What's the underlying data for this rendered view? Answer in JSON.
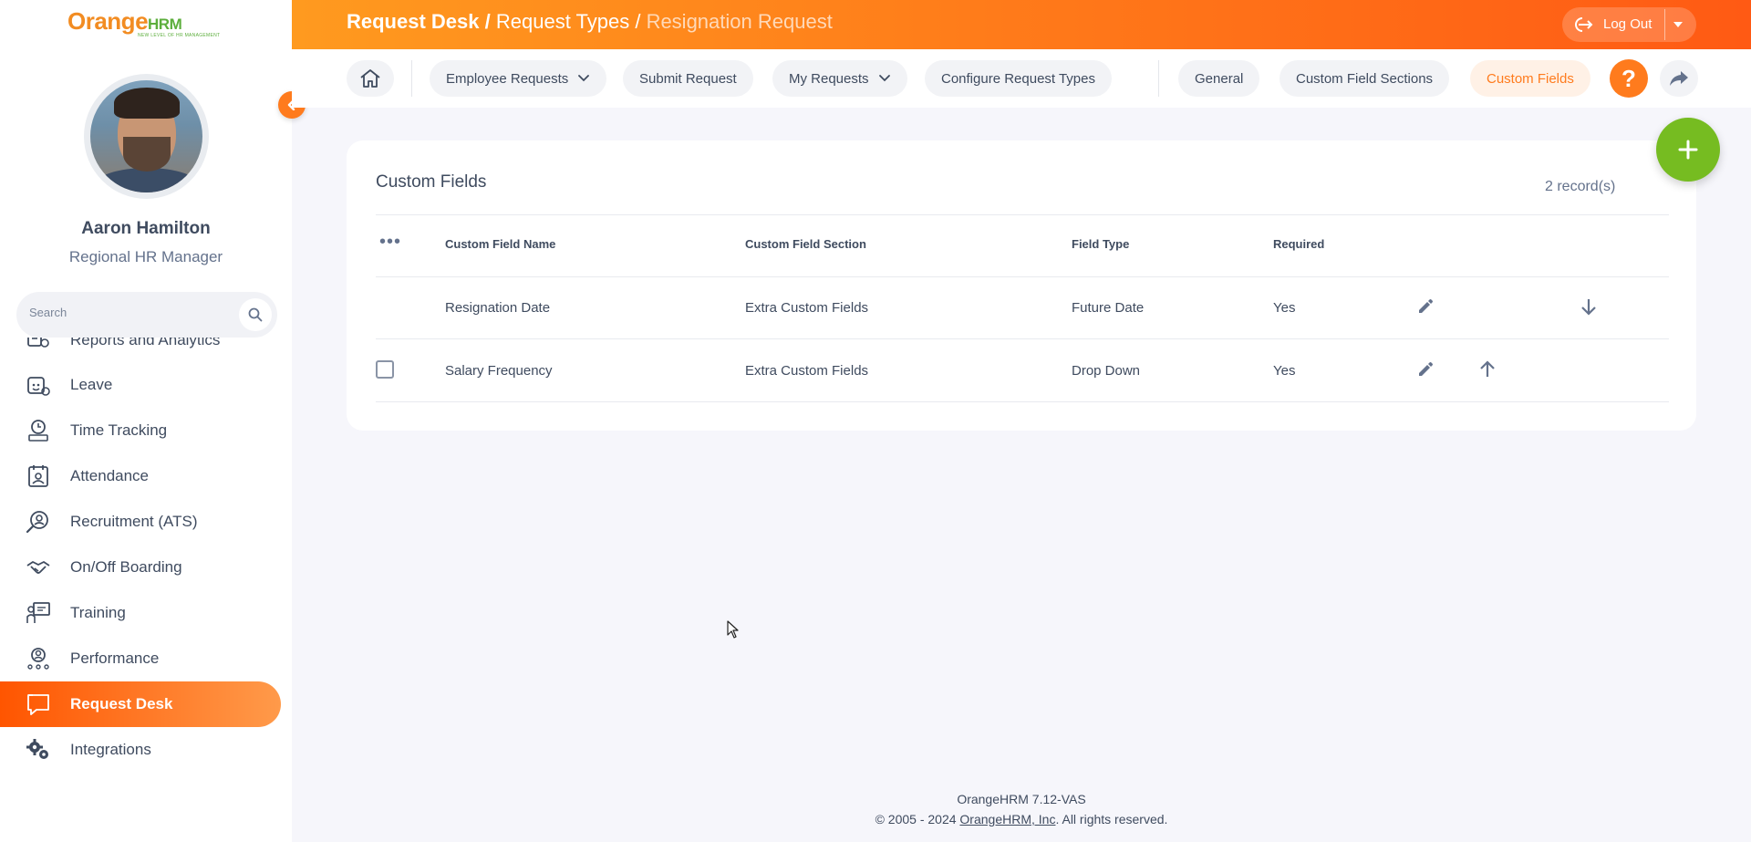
{
  "app": {
    "logo_main": "Orange",
    "logo_sub": "HRM",
    "logo_tagline": "NEW LEVEL OF HR MANAGEMENT"
  },
  "user": {
    "name": "Aaron Hamilton",
    "role": "Regional HR Manager"
  },
  "sidebar": {
    "search_placeholder": "Search",
    "items": [
      {
        "label": "Reports and Analytics",
        "icon": "reports-icon",
        "active": false
      },
      {
        "label": "Leave",
        "icon": "leave-icon",
        "active": false
      },
      {
        "label": "Time Tracking",
        "icon": "time-tracking-icon",
        "active": false
      },
      {
        "label": "Attendance",
        "icon": "attendance-icon",
        "active": false
      },
      {
        "label": "Recruitment (ATS)",
        "icon": "recruitment-icon",
        "active": false
      },
      {
        "label": "On/Off Boarding",
        "icon": "onboarding-icon",
        "active": false
      },
      {
        "label": "Training",
        "icon": "training-icon",
        "active": false
      },
      {
        "label": "Performance",
        "icon": "performance-icon",
        "active": false
      },
      {
        "label": "Request Desk",
        "icon": "request-desk-icon",
        "active": true
      },
      {
        "label": "Integrations",
        "icon": "integrations-icon",
        "active": false
      }
    ]
  },
  "header": {
    "crumb1": "Request Desk",
    "sep1": " / ",
    "crumb2": "Request Types",
    "sep2": " / ",
    "crumb3": "Resignation Request",
    "logout_label": "Log Out"
  },
  "subnav": {
    "employee_requests": "Employee Requests",
    "submit_request": "Submit Request",
    "my_requests": "My Requests",
    "configure_request_types": "Configure Request Types",
    "general": "General",
    "custom_field_sections": "Custom Field Sections",
    "custom_fields": "Custom Fields",
    "help": "?"
  },
  "card": {
    "title": "Custom Fields",
    "record_count": "2 record(s)",
    "columns": {
      "name": "Custom Field Name",
      "section": "Custom Field Section",
      "type": "Field Type",
      "required": "Required"
    },
    "rows": [
      {
        "name": "Resignation Date",
        "section": "Extra Custom Fields",
        "type": "Future Date",
        "required": "Yes"
      },
      {
        "name": "Salary Frequency",
        "section": "Extra Custom Fields",
        "type": "Drop Down",
        "required": "Yes"
      }
    ]
  },
  "footer": {
    "version": "OrangeHRM 7.12-VAS",
    "copy_prefix": "© 2005 - 2024 ",
    "copy_link": "OrangeHRM, Inc",
    "copy_suffix": ". All rights reserved."
  },
  "colors": {
    "accent": "#ff7b1d",
    "fab": "#76bc21",
    "active_menu_start": "#ff5500",
    "active_menu_end": "#ff9a4a"
  }
}
